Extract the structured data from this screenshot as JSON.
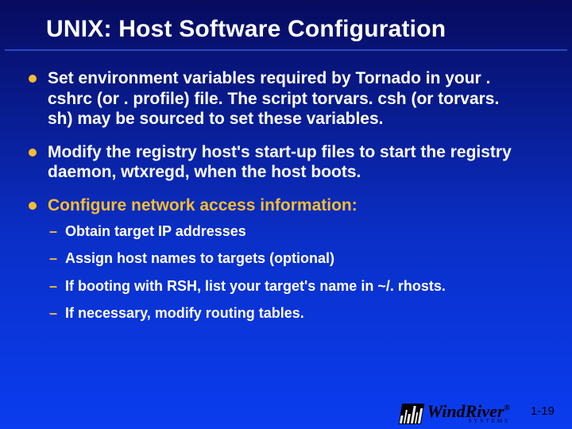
{
  "title": "UNIX: Host Software Configuration",
  "bullets": {
    "b1": "Set environment variables required by Tornado in your . cshrc (or . profile) file. The script torvars. csh (or torvars. sh) may be sourced to set these variables.",
    "b2": "Modify the registry host's start-up files to start the registry daemon, wtxregd, when the host boots.",
    "b3": "Configure network access information:"
  },
  "subs": {
    "s1": "Obtain target IP addresses",
    "s2": "Assign host names to targets (optional)",
    "s3": "If booting with RSH, list your target's name in ~/. rhosts.",
    "s4": "If necessary, modify routing tables."
  },
  "brand": {
    "name": "WindRiver",
    "reg": "®",
    "sys": "SYSTEMS"
  },
  "page": "1-19"
}
